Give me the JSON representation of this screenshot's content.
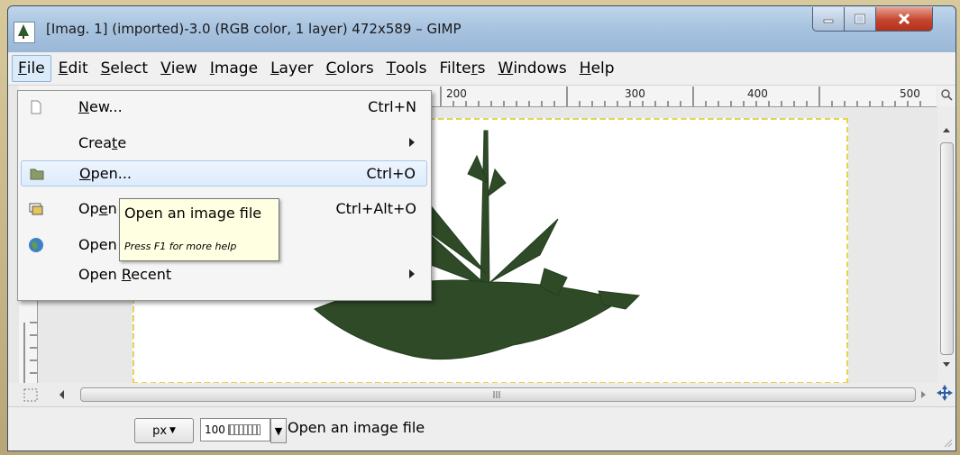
{
  "window": {
    "title": "[Imag. 1] (imported)-3.0 (RGB color, 1 layer) 472x589 – GIMP"
  },
  "menubar": {
    "items": [
      {
        "label": "File",
        "mn": "F",
        "rest": "ile",
        "active": true
      },
      {
        "label": "Edit",
        "mn": "E",
        "rest": "dit"
      },
      {
        "label": "Select",
        "mn": "S",
        "rest": "elect"
      },
      {
        "label": "View",
        "mn": "V",
        "rest": "iew"
      },
      {
        "label": "Image",
        "mn": "I",
        "rest": "mage"
      },
      {
        "label": "Layer",
        "mn": "L",
        "rest": "ayer"
      },
      {
        "label": "Colors",
        "mn": "C",
        "rest": "olors"
      },
      {
        "label": "Tools",
        "mn": "T",
        "rest": "ools"
      },
      {
        "label": "Filters",
        "pre": "Filte",
        "mn": "r",
        "rest": "s"
      },
      {
        "label": "Windows",
        "mn": "W",
        "rest": "indows"
      },
      {
        "label": "Help",
        "mn": "H",
        "rest": "elp"
      }
    ]
  },
  "file_menu": {
    "items": [
      {
        "id": "new",
        "pre": "",
        "mn": "N",
        "rest": "ew...",
        "shortcut": "Ctrl+N",
        "icon": "new-document-icon"
      },
      {
        "id": "create",
        "pre": "Crea",
        "mn": "t",
        "rest": "e",
        "submenu": true
      },
      {
        "id": "open",
        "pre": "",
        "mn": "O",
        "rest": "pen...",
        "shortcut": "Ctrl+O",
        "icon": "folder-open-icon",
        "highlighted": true
      },
      {
        "id": "open-as-layers",
        "pre": "Op",
        "mn": "e",
        "rest": "n as Layers...",
        "shortcut": "Ctrl+Alt+O",
        "icon": "open-layers-icon"
      },
      {
        "id": "open-location",
        "pre": "Open",
        "mn": "",
        "rest": " Location...",
        "icon": "globe-icon"
      },
      {
        "id": "open-recent",
        "pre": "Open ",
        "mn": "R",
        "rest": "ecent",
        "submenu": true
      }
    ]
  },
  "tooltip": {
    "title": "Open an image file",
    "help": "Press F1 for more help"
  },
  "ruler": {
    "top_labels": [
      "200",
      "300",
      "400",
      "500"
    ]
  },
  "statusbar": {
    "unit": "px",
    "zoom": "100",
    "message": "Open an image file"
  }
}
